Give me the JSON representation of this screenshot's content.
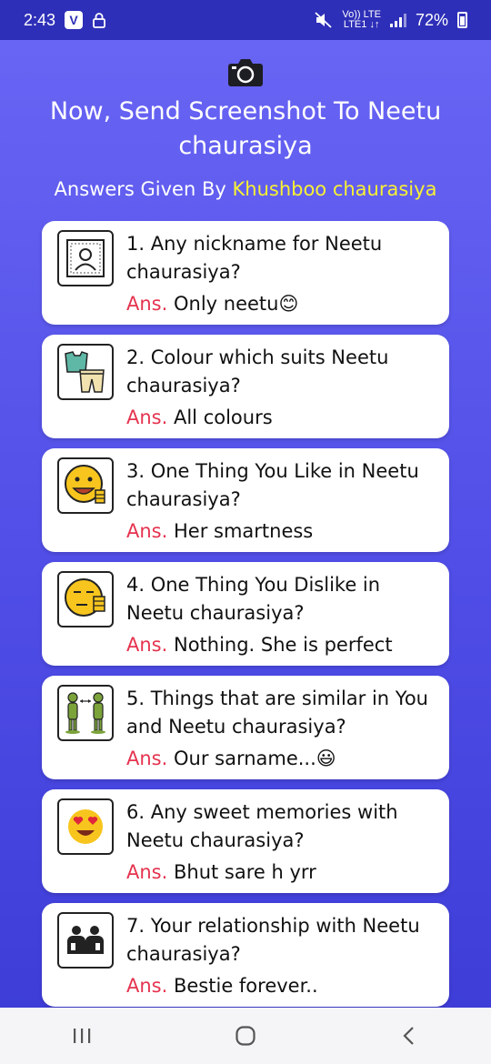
{
  "status_bar": {
    "time": "2:43",
    "v_badge": "V",
    "network_top": "Vo)) LTE",
    "network_bottom": "LTE1 ↓↑",
    "battery_percent": "72%"
  },
  "header": {
    "title": "Now, Send Screenshot To Neetu chaurasiya",
    "answers_prefix": "Answers Given By",
    "answers_name": "Khushboo chaurasiya"
  },
  "cards": [
    {
      "question": "1. Any nickname for Neetu chaurasiya?",
      "ans_label": "Ans.",
      "answer": "Only neetu😊",
      "icon": "portrait-frame-icon"
    },
    {
      "question": "2. Colour which suits Neetu chaurasiya?",
      "ans_label": "Ans.",
      "answer": "All colours",
      "icon": "clothes-icon"
    },
    {
      "question": "3. One Thing You Like in Neetu chaurasiya?",
      "ans_label": "Ans.",
      "answer": "Her smartness",
      "icon": "thumbs-up-smiley-icon"
    },
    {
      "question": "4. One Thing You Dislike in Neetu chaurasiya?",
      "ans_label": "Ans.",
      "answer": "Nothing. She is perfect",
      "icon": "thumbs-down-smiley-icon"
    },
    {
      "question": "5. Things that are similar in You and Neetu chaurasiya?",
      "ans_label": "Ans.",
      "answer": "Our sarname...😃",
      "icon": "two-people-compare-icon"
    },
    {
      "question": "6. Any sweet memories with Neetu chaurasiya?",
      "ans_label": "Ans.",
      "answer": "Bhut sare h yrr",
      "icon": "heart-eyes-smiley-icon"
    },
    {
      "question": "7. Your relationship with Neetu chaurasiya?",
      "ans_label": "Ans.",
      "answer": "Bestie forever..",
      "icon": "couple-icon"
    }
  ],
  "colors": {
    "background_top": "#6a66f5",
    "background_bottom": "#3c3bd6",
    "status_bar": "#2e2fb8",
    "ans_label": "#e5334f",
    "highlight_name": "#f8f133"
  },
  "nav_bar": {
    "recents": "recents-icon",
    "home": "home-icon",
    "back": "back-icon"
  }
}
